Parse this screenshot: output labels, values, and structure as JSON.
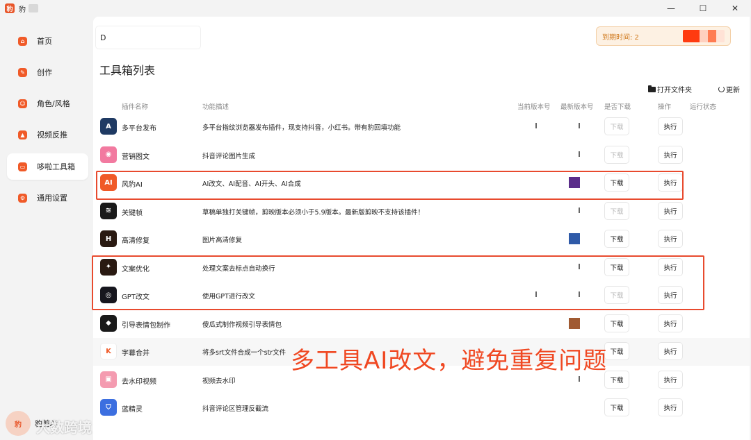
{
  "window": {
    "title": "豹",
    "controls": [
      "—",
      "☐",
      "✕"
    ]
  },
  "sidebar": {
    "items": [
      {
        "label": "首页",
        "icon": "home-icon"
      },
      {
        "label": "创作",
        "icon": "create-icon"
      },
      {
        "label": "角色/风格",
        "icon": "role-icon"
      },
      {
        "label": "视频反推",
        "icon": "video-reverse-icon"
      },
      {
        "label": "哆啦工具箱",
        "icon": "toolbox-icon",
        "active": true
      },
      {
        "label": "通用设置",
        "icon": "settings-icon"
      }
    ],
    "footer_name": "豹剪AI",
    "footer_logo_text": "豹"
  },
  "header": {
    "search_value": "D",
    "expire_label": "到期时间: 2"
  },
  "page": {
    "title": "工具箱列表",
    "open_folder_label": "打开文件夹",
    "refresh_label": "更新"
  },
  "table": {
    "columns": {
      "name": "插件名称",
      "desc": "功能描述",
      "current_version": "当前版本号",
      "latest_version": "最新版本号",
      "download": "是否下载",
      "action": "操作",
      "status": "运行状态"
    },
    "download_label": "下载",
    "run_label": "执行",
    "rows": [
      {
        "name": "多平台发布",
        "desc": "多平台指纹浏览器发布插件，现支持抖音，小红书。带有豹回填功能",
        "icon_color": "#1f3a63",
        "icon_text": "A",
        "has_current": true,
        "latest": "bar",
        "download_enabled": false
      },
      {
        "name": "营销图文",
        "desc": "抖音评论图片生成",
        "icon_color": "#f27aa0",
        "icon_text": "◉",
        "has_current": false,
        "latest": "bar",
        "download_enabled": false
      },
      {
        "name": "风豹AI",
        "desc": "AI改文、AI配音、AI开头、AI合成",
        "icon_color": "#f05a28",
        "icon_text": "AI",
        "has_current": false,
        "latest": "swatch",
        "latest_color": "#5b2d8a",
        "download_enabled": true
      },
      {
        "name": "关键帧",
        "desc": "草稿单独打关键帧，剪映版本必须小于5.9版本。最新版剪映不支持该插件！",
        "icon_color": "#1a1a1a",
        "icon_text": "≋",
        "has_current": false,
        "latest": "bar",
        "download_enabled": false
      },
      {
        "name": "高清修复",
        "desc": "图片高清修复",
        "icon_color": "#2a1a12",
        "icon_text": "H",
        "has_current": false,
        "latest": "swatch",
        "latest_color": "#2f5aa8",
        "download_enabled": true
      },
      {
        "name": "文案优化",
        "desc": "处理文案去标点自动换行",
        "icon_color": "#2a1a12",
        "icon_text": "✦",
        "has_current": false,
        "latest": "bar",
        "download_enabled": true
      },
      {
        "name": "GPT改文",
        "desc": "使用GPT进行改文",
        "icon_color": "#16161e",
        "icon_text": "◎",
        "has_current": true,
        "latest": "bar",
        "download_enabled": false
      },
      {
        "name": "引导表情包制作",
        "desc": "傻瓜式制作视频引导表情包",
        "icon_color": "#1a1a1a",
        "icon_text": "◆",
        "has_current": false,
        "latest": "swatch",
        "latest_color": "#a05a32",
        "download_enabled": true
      },
      {
        "name": "字幕合并",
        "desc": "将多srt文件合成一个str文件",
        "icon_color": "#ffffff",
        "icon_text": "K",
        "has_current": false,
        "latest": "none",
        "download_enabled": true,
        "hover": true
      },
      {
        "name": "去水印视频",
        "desc": "视频去水印",
        "icon_color": "#f49bb0",
        "icon_text": "▣",
        "has_current": false,
        "latest": "bar",
        "download_enabled": true
      },
      {
        "name": "蓝精灵",
        "desc": "抖音评论区管理反截流",
        "icon_color": "#3c6fe0",
        "icon_text": "⛉",
        "has_current": false,
        "latest": "none",
        "download_enabled": true
      }
    ]
  },
  "annotation": {
    "text": "多工具AI改文，避免重复问题",
    "color": "#f04822"
  },
  "watermark": "大数跨境"
}
